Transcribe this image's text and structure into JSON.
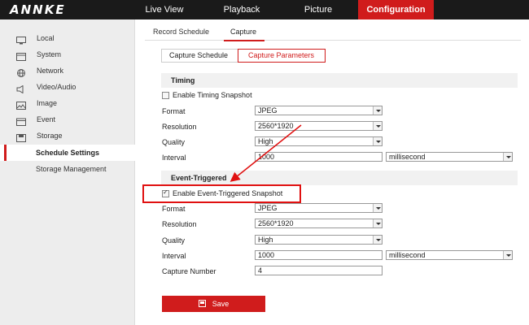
{
  "app": {
    "logo": "ANNKE"
  },
  "topnav": [
    {
      "label": "Live View"
    },
    {
      "label": "Playback"
    },
    {
      "label": "Picture"
    },
    {
      "label": "Configuration",
      "active": true
    }
  ],
  "sidebar": {
    "items": [
      {
        "label": "Local",
        "icon": "monitor-icon"
      },
      {
        "label": "System",
        "icon": "system-icon"
      },
      {
        "label": "Network",
        "icon": "globe-icon"
      },
      {
        "label": "Video/Audio",
        "icon": "speaker-icon"
      },
      {
        "label": "Image",
        "icon": "image-icon"
      },
      {
        "label": "Event",
        "icon": "calendar-icon"
      },
      {
        "label": "Storage",
        "icon": "disk-icon"
      },
      {
        "label": "Schedule Settings",
        "active": true
      },
      {
        "label": "Storage Management"
      }
    ]
  },
  "tabs": [
    {
      "label": "Record Schedule"
    },
    {
      "label": "Capture",
      "active": true
    }
  ],
  "subtabs": [
    {
      "label": "Capture Schedule"
    },
    {
      "label": "Capture Parameters",
      "active": true
    }
  ],
  "timing": {
    "section_title": "Timing",
    "enable_label": "Enable Timing Snapshot",
    "enable_checked": false,
    "format_label": "Format",
    "format_value": "JPEG",
    "resolution_label": "Resolution",
    "resolution_value": "2560*1920",
    "quality_label": "Quality",
    "quality_value": "High",
    "interval_label": "Interval",
    "interval_value": "1000",
    "interval_unit": "millisecond"
  },
  "event": {
    "section_title": "Event-Triggered",
    "enable_label": "Enable Event-Triggered Snapshot",
    "enable_checked": true,
    "format_label": "Format",
    "format_value": "JPEG",
    "resolution_label": "Resolution",
    "resolution_value": "2560*1920",
    "quality_label": "Quality",
    "quality_value": "High",
    "interval_label": "Interval",
    "interval_value": "1000",
    "interval_unit": "millisecond",
    "capture_number_label": "Capture Number",
    "capture_number_value": "4"
  },
  "save_label": "Save",
  "colors": {
    "accent": "#d01c1c",
    "topbar": "#1a1a1a",
    "sidebar": "#ededed"
  }
}
